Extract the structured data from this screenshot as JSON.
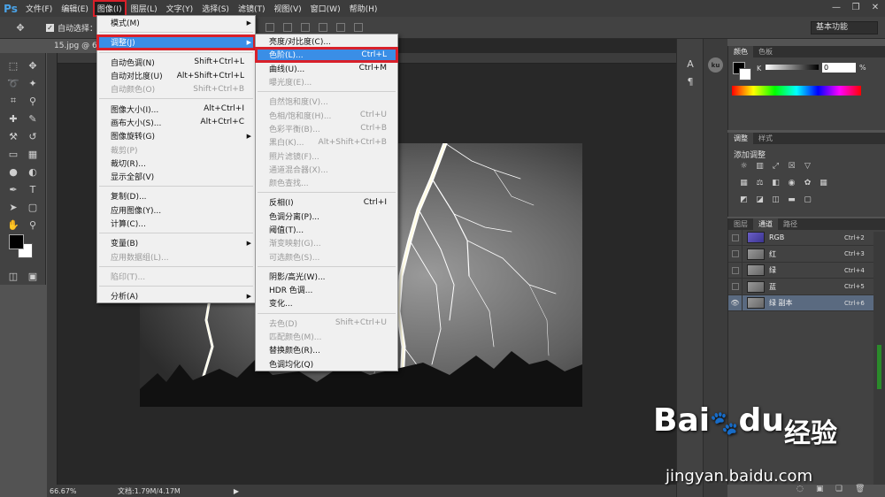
{
  "app": {
    "logo": "Ps"
  },
  "menubar": {
    "items": [
      "文件(F)",
      "编辑(E)",
      "图像(I)",
      "图层(L)",
      "文字(Y)",
      "选择(S)",
      "滤镜(T)",
      "视图(V)",
      "窗口(W)",
      "帮助(H)"
    ],
    "active_index": 2
  },
  "window_controls": {
    "minimize": "—",
    "restore": "❐",
    "close": "✕"
  },
  "options_bar": {
    "auto_select_label": "自动选择：",
    "auto_select_checked": true,
    "workspace": "基本功能"
  },
  "document": {
    "tab_title": "15.jpg @ 6",
    "zoom": "66.67%",
    "doc_info": "文档:1.79M/4.17M"
  },
  "image_menu": {
    "items": [
      {
        "label": "模式(M)",
        "shortcut": "",
        "submenu": true,
        "state": "normal"
      },
      {
        "sep": true
      },
      {
        "label": "调整(J)",
        "shortcut": "",
        "submenu": true,
        "state": "highlight-boxed"
      },
      {
        "sep": true
      },
      {
        "label": "自动色调(N)",
        "shortcut": "Shift+Ctrl+L",
        "state": "normal"
      },
      {
        "label": "自动对比度(U)",
        "shortcut": "Alt+Shift+Ctrl+L",
        "state": "normal"
      },
      {
        "label": "自动颜色(O)",
        "shortcut": "Shift+Ctrl+B",
        "state": "disabled"
      },
      {
        "sep": true
      },
      {
        "label": "图像大小(I)...",
        "shortcut": "Alt+Ctrl+I",
        "state": "normal"
      },
      {
        "label": "画布大小(S)...",
        "shortcut": "Alt+Ctrl+C",
        "state": "normal"
      },
      {
        "label": "图像旋转(G)",
        "shortcut": "",
        "submenu": true,
        "state": "normal"
      },
      {
        "label": "裁剪(P)",
        "shortcut": "",
        "state": "disabled"
      },
      {
        "label": "裁切(R)...",
        "shortcut": "",
        "state": "normal"
      },
      {
        "label": "显示全部(V)",
        "shortcut": "",
        "state": "normal"
      },
      {
        "sep": true
      },
      {
        "label": "复制(D)...",
        "shortcut": "",
        "state": "normal"
      },
      {
        "label": "应用图像(Y)...",
        "shortcut": "",
        "state": "normal"
      },
      {
        "label": "计算(C)...",
        "shortcut": "",
        "state": "normal"
      },
      {
        "sep": true
      },
      {
        "label": "变量(B)",
        "shortcut": "",
        "submenu": true,
        "state": "normal"
      },
      {
        "label": "应用数据组(L)...",
        "shortcut": "",
        "state": "disabled"
      },
      {
        "sep": true
      },
      {
        "label": "陷印(T)...",
        "shortcut": "",
        "state": "disabled"
      },
      {
        "sep": true
      },
      {
        "label": "分析(A)",
        "shortcut": "",
        "submenu": true,
        "state": "normal"
      }
    ]
  },
  "adjust_menu": {
    "items": [
      {
        "label": "亮度/对比度(C)...",
        "shortcut": "",
        "state": "normal"
      },
      {
        "label": "色阶(L)...",
        "shortcut": "Ctrl+L",
        "state": "highlight-boxed"
      },
      {
        "label": "曲线(U)...",
        "shortcut": "Ctrl+M",
        "state": "normal"
      },
      {
        "label": "曝光度(E)...",
        "shortcut": "",
        "state": "disabled"
      },
      {
        "sep": true
      },
      {
        "label": "自然饱和度(V)...",
        "shortcut": "",
        "state": "disabled"
      },
      {
        "label": "色相/饱和度(H)...",
        "shortcut": "Ctrl+U",
        "state": "disabled"
      },
      {
        "label": "色彩平衡(B)...",
        "shortcut": "Ctrl+B",
        "state": "disabled"
      },
      {
        "label": "黑白(K)...",
        "shortcut": "Alt+Shift+Ctrl+B",
        "state": "disabled"
      },
      {
        "label": "照片滤镜(F)...",
        "shortcut": "",
        "state": "disabled"
      },
      {
        "label": "通道混合器(X)...",
        "shortcut": "",
        "state": "disabled"
      },
      {
        "label": "颜色查找...",
        "shortcut": "",
        "state": "disabled"
      },
      {
        "sep": true
      },
      {
        "label": "反相(I)",
        "shortcut": "Ctrl+I",
        "state": "normal"
      },
      {
        "label": "色调分离(P)...",
        "shortcut": "",
        "state": "normal"
      },
      {
        "label": "阈值(T)...",
        "shortcut": "",
        "state": "normal"
      },
      {
        "label": "渐变映射(G)...",
        "shortcut": "",
        "state": "disabled"
      },
      {
        "label": "可选颜色(S)...",
        "shortcut": "",
        "state": "disabled"
      },
      {
        "sep": true
      },
      {
        "label": "阴影/高光(W)...",
        "shortcut": "",
        "state": "normal"
      },
      {
        "label": "HDR 色调...",
        "shortcut": "",
        "state": "normal"
      },
      {
        "label": "变化...",
        "shortcut": "",
        "state": "normal"
      },
      {
        "sep": true
      },
      {
        "label": "去色(D)",
        "shortcut": "Shift+Ctrl+U",
        "state": "disabled"
      },
      {
        "label": "匹配颜色(M)...",
        "shortcut": "",
        "state": "disabled"
      },
      {
        "label": "替换颜色(R)...",
        "shortcut": "",
        "state": "normal"
      },
      {
        "label": "色调均化(Q)",
        "shortcut": "",
        "state": "normal"
      }
    ]
  },
  "color_panel": {
    "tabs": [
      "颜色",
      "色板"
    ],
    "k_label": "K",
    "k_value": "0",
    "percent": "%"
  },
  "adjust_panel": {
    "tabs": [
      "调整",
      "样式"
    ],
    "title": "添加调整"
  },
  "channels_panel": {
    "tabs": [
      "图层",
      "通道",
      "路径"
    ],
    "active_tab_index": 1,
    "channels": [
      {
        "name": "RGB",
        "shortcut": "Ctrl+2",
        "visible": false,
        "selected": false,
        "type": "rgb"
      },
      {
        "name": "红",
        "shortcut": "Ctrl+3",
        "visible": false,
        "selected": false,
        "type": "gray"
      },
      {
        "name": "绿",
        "shortcut": "Ctrl+4",
        "visible": false,
        "selected": false,
        "type": "gray"
      },
      {
        "name": "蓝",
        "shortcut": "Ctrl+5",
        "visible": false,
        "selected": false,
        "type": "gray"
      },
      {
        "name": "绿 副本",
        "shortcut": "Ctrl+6",
        "visible": true,
        "selected": true,
        "type": "gray"
      }
    ]
  },
  "side_strip": {
    "ku_label": "ku"
  },
  "watermark": {
    "logo": "Bai",
    "logo_suffix": "du",
    "cn": "经验",
    "url": "jingyan.baidu.com"
  },
  "colors": {
    "accent": "#3a8ee6",
    "highlight_box": "#d8202a",
    "selected_channel": "#5a6a80"
  }
}
